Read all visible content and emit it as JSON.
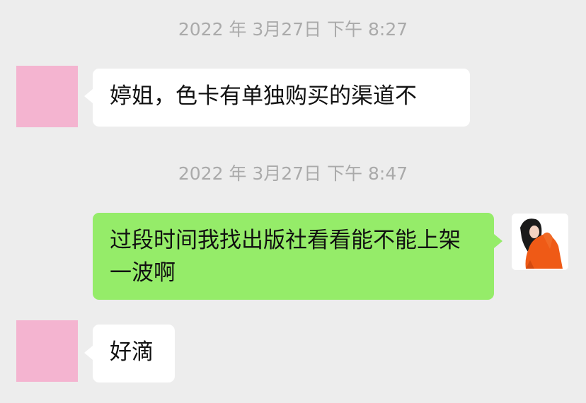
{
  "chat": {
    "timestamps": [
      "2022 年 3月27日 下午 8:27",
      "2022 年 3月27日 下午 8:47"
    ],
    "messages": [
      {
        "side": "left",
        "avatar": "pink-square-avatar",
        "text": "婷姐，色卡有单独购买的渠道不"
      },
      {
        "side": "right",
        "avatar": "photo-avatar",
        "text": "过段时间我找出版社看看能不能上架一波啊"
      },
      {
        "side": "left",
        "avatar": "pink-square-avatar",
        "text": "好滴"
      }
    ]
  },
  "colors": {
    "background": "#ededed",
    "incoming_bubble": "#ffffff",
    "outgoing_bubble": "#95ec69",
    "timestamp_text": "#aaaaaa",
    "avatar_pink": "#f4b4d0"
  }
}
